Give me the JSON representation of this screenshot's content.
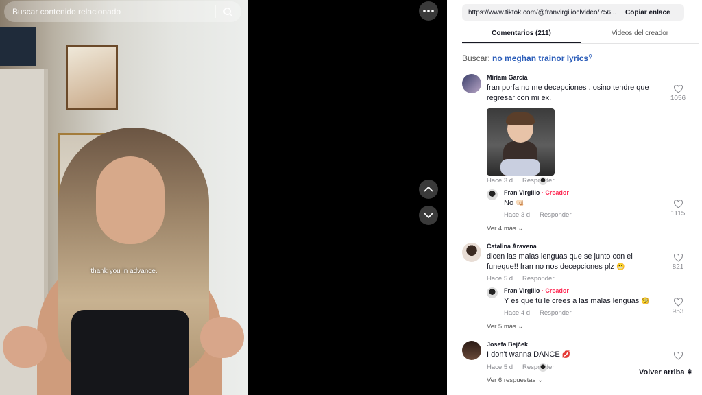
{
  "search": {
    "placeholder": "Buscar contenido relacionado"
  },
  "video": {
    "caption": "thank you in advance."
  },
  "link": {
    "url": "https://www.tiktok.com/@franvirgilioclvideo/756...",
    "copy_label": "Copiar enlace"
  },
  "tabs": [
    {
      "label": "Comentarios (211)",
      "active": true
    },
    {
      "label": "Videos del creador",
      "active": false
    }
  ],
  "related": {
    "prefix": "Buscar:",
    "query": "no meghan trainor lyrics"
  },
  "comments": [
    {
      "name": "Miriam Garcia",
      "text": "fran porfa no me decepciones . osino tendre que regresar con mi ex.",
      "likes": "1056",
      "time": "Hace 3 d",
      "reply_label": "Responder",
      "has_gif": true,
      "reply": {
        "name": "Fran Virgilio",
        "badge": "· Creador",
        "text": "No",
        "emoji": "👊🏻",
        "time": "Hace 3 d",
        "reply_label": "Responder",
        "likes": "1115"
      },
      "more": "Ver 4 más"
    },
    {
      "name": "Catalina Aravena",
      "text": "dicen las malas lenguas que se junto con el funeque!! fran no nos decepciones plz",
      "emoji": "😬",
      "likes": "821",
      "time": "Hace 5 d",
      "reply_label": "Responder",
      "reply": {
        "name": "Fran Virgilio",
        "badge": "· Creador",
        "text": "Y es que tú le crees a las malas lenguas",
        "emoji": "🧐",
        "time": "Hace 4 d",
        "reply_label": "Responder",
        "likes": "953"
      },
      "more": "Ver 5 más"
    },
    {
      "name": "Josefa Bejček",
      "text": "I don't wanna DANCE",
      "emoji": "💋",
      "time": "Hace 5 d",
      "reply_label": "Responder",
      "more": "Ver 6 respuestas"
    }
  ],
  "back_to_top": "Volver arriba"
}
